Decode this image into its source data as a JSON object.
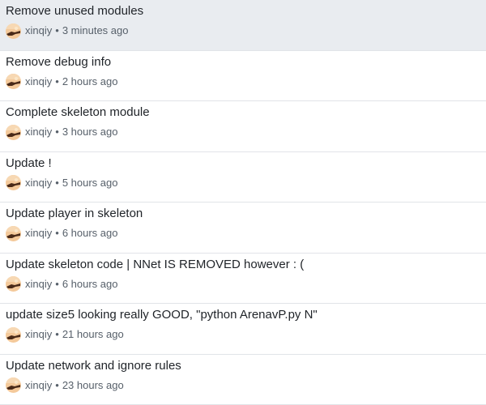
{
  "commits": [
    {
      "message": "Remove unused modules",
      "author": "xinqiy",
      "separator": "•",
      "time": "3 minutes ago"
    },
    {
      "message": "Remove debug info",
      "author": "xinqiy",
      "separator": "•",
      "time": "2 hours ago"
    },
    {
      "message": "Complete skeleton module",
      "author": "xinqiy",
      "separator": "•",
      "time": "3 hours ago"
    },
    {
      "message": "Update !",
      "author": "xinqiy",
      "separator": "•",
      "time": "5 hours ago"
    },
    {
      "message": "Update player in skeleton",
      "author": "xinqiy",
      "separator": "•",
      "time": "6 hours ago"
    },
    {
      "message": "Update skeleton code | NNet IS REMOVED however : (",
      "author": "xinqiy",
      "separator": "•",
      "time": "6 hours ago"
    },
    {
      "message": "update size5 looking really GOOD, \"python ArenavP.py N\"",
      "author": "xinqiy",
      "separator": "•",
      "time": "21 hours ago"
    },
    {
      "message": "Update network and ignore rules",
      "author": "xinqiy",
      "separator": "•",
      "time": "23 hours ago"
    }
  ],
  "selected_index": 0,
  "colors": {
    "selected_background": "#e9ecf0",
    "message_text": "#1f2328",
    "meta_text": "#57606a",
    "divider": "#e1e4e8"
  },
  "avatar_icon": "user-avatar-icon"
}
